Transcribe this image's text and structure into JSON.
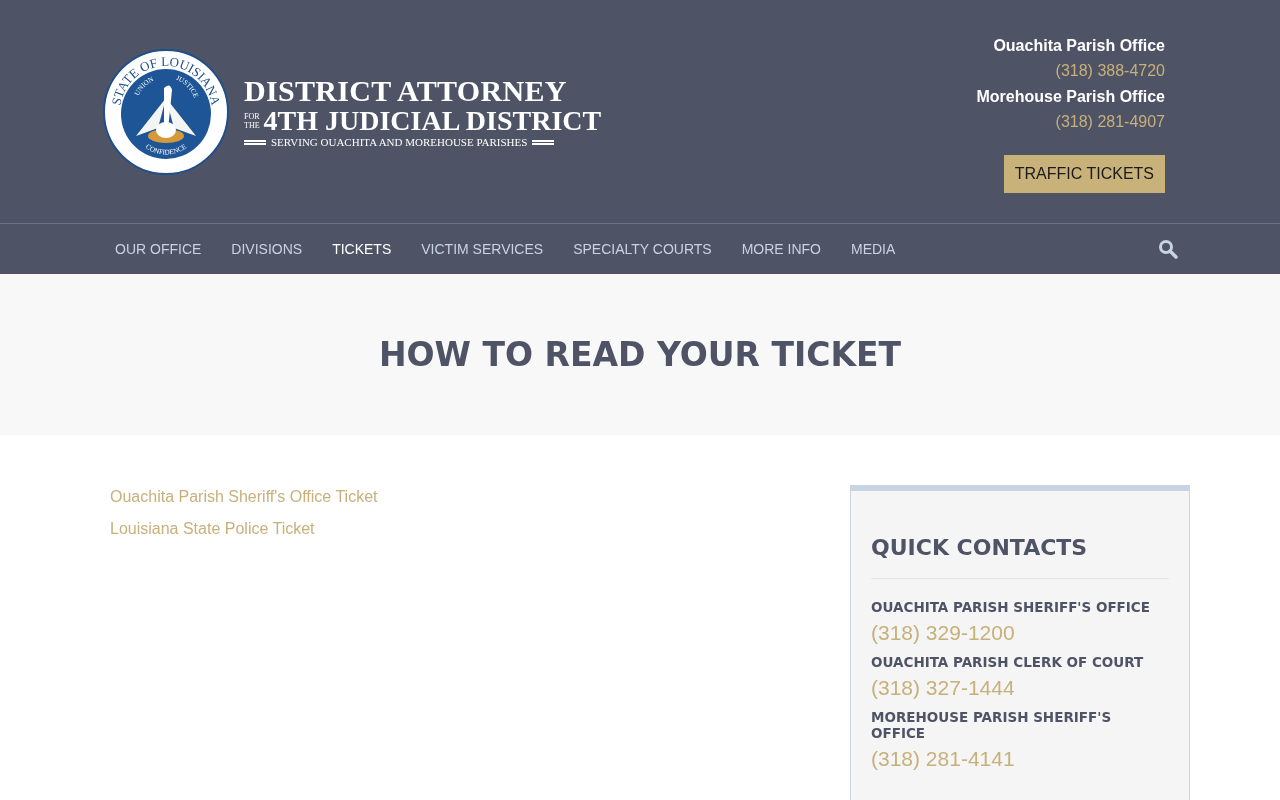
{
  "header": {
    "seal": {
      "ring_text": "STATE OF LOUISIANA",
      "motto_left": "UNION",
      "motto_right": "JUSTICE",
      "motto_bottom": "CONFIDENCE"
    },
    "logo": {
      "line_1": "DISTRICT ATTORNEY",
      "for": "FOR",
      "the": "THE",
      "line_2": "4TH JUDICIAL DISTRICT",
      "tagline": "SERVING OUACHITA AND MOREHOUSE PARISHES"
    },
    "contacts": [
      {
        "office": "Ouachita Parish Office",
        "phone": "(318) 388-4720"
      },
      {
        "office": "Morehouse Parish Office",
        "phone": "(318) 281-4907"
      }
    ],
    "button": "TRAFFIC TICKETS"
  },
  "nav": [
    {
      "label": "OUR OFFICE",
      "selected": false
    },
    {
      "label": "DIVISIONS",
      "selected": false
    },
    {
      "label": "TICKETS",
      "selected": true
    },
    {
      "label": "VICTIM SERVICES",
      "selected": false
    },
    {
      "label": "SPECIALTY COURTS",
      "selected": false
    },
    {
      "label": "MORE INFO",
      "selected": false
    },
    {
      "label": "MEDIA",
      "selected": false
    }
  ],
  "page_title": "HOW TO READ YOUR TICKET",
  "links": [
    "Ouachita Parish Sheriff's Office Ticket",
    "Louisiana State Police Ticket"
  ],
  "sidebar": {
    "title": "QUICK CONTACTS",
    "contacts": [
      {
        "name": "OUACHITA PARISH SHERIFF'S OFFICE",
        "phone": "(318) 329-1200"
      },
      {
        "name": "OUACHITA PARISH CLERK OF COURT",
        "phone": "(318) 327-1444"
      },
      {
        "name": "MOREHOUSE PARISH SHERIFF'S OFFICE",
        "phone": "(318) 281-4141"
      }
    ]
  }
}
